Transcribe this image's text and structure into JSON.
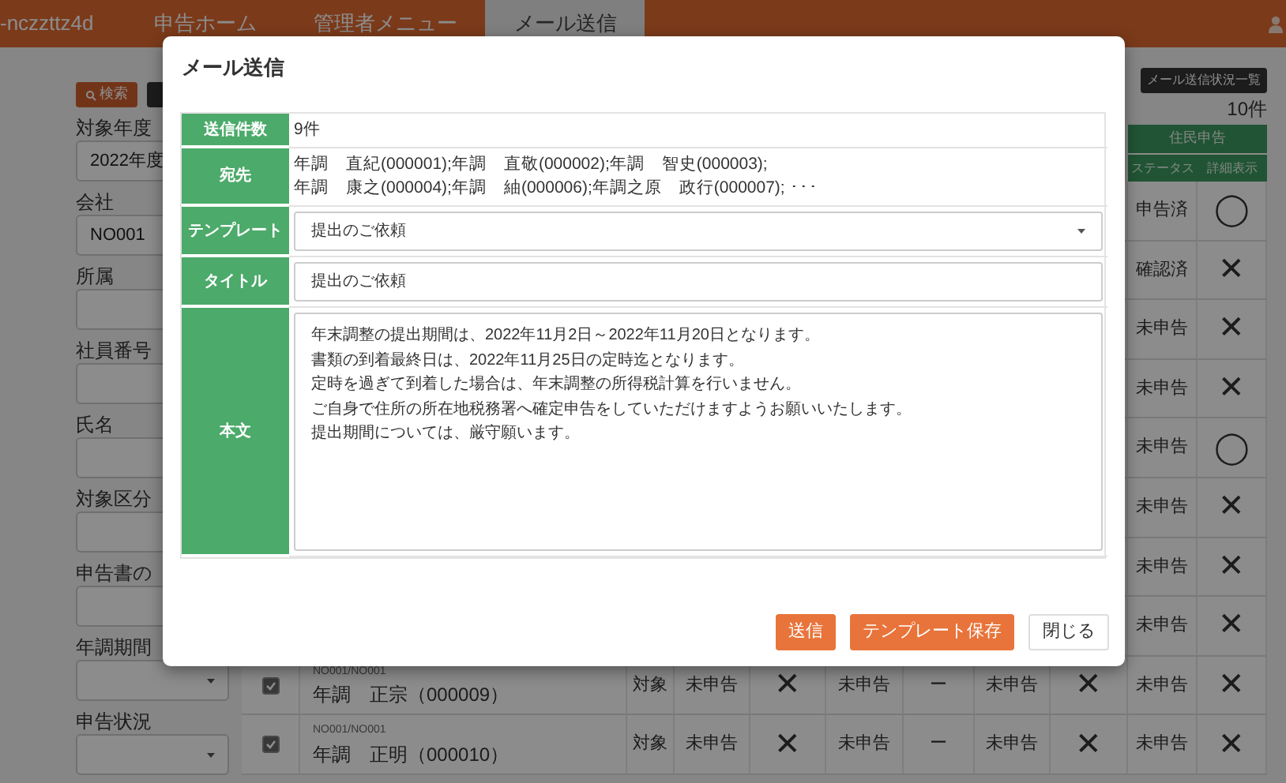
{
  "navbar": {
    "brand": "-nczzttz4d",
    "items": [
      {
        "label": "申告ホーム",
        "selected": false
      },
      {
        "label": "管理者メニュー",
        "selected": false
      },
      {
        "label": "メール送信",
        "selected": true
      }
    ]
  },
  "sidebar": {
    "search_button": "検索",
    "filters": [
      {
        "label": "対象年度",
        "kind": "select",
        "value": "2022年度"
      },
      {
        "label": "会社",
        "kind": "input",
        "value": "NO001"
      },
      {
        "label": "所属",
        "kind": "input"
      },
      {
        "label": "社員番号",
        "kind": "input"
      },
      {
        "label": "氏名",
        "kind": "input"
      },
      {
        "label": "対象区分",
        "kind": "input"
      },
      {
        "label": "申告書の",
        "kind": "input"
      },
      {
        "label": "年調期間",
        "kind": "select"
      },
      {
        "label": "申告状況",
        "kind": "select"
      }
    ]
  },
  "results": {
    "status_button": "メール送信状況一覧",
    "count": "10件",
    "header_group": "住民申告",
    "headers": [
      "ステータス",
      "詳細表示"
    ],
    "rows": [
      {
        "cells": [
          "申告済",
          "◯"
        ]
      },
      {
        "cells": [
          "確認済",
          "✕"
        ]
      },
      {
        "cells": [
          "未申告",
          "✕"
        ]
      },
      {
        "cells": [
          "未申告",
          "✕"
        ]
      },
      {
        "cells": [
          "未申告",
          "◯"
        ]
      },
      {
        "cells": [
          "未申告",
          "✕"
        ]
      },
      {
        "cells": [
          "未申告",
          "✕"
        ]
      },
      {
        "cells": [
          "未申告",
          "✕"
        ]
      },
      {
        "checked": true,
        "company": "NO001/NO001",
        "name": "年調　正宗（000009）",
        "cells": [
          "対象",
          "未申告",
          "✕",
          "未申告",
          "ー",
          "未申告",
          "✕",
          "未申告",
          "✕"
        ]
      },
      {
        "checked": true,
        "company": "NO001/NO001",
        "name": "年調　正明（000010）",
        "cells": [
          "対象",
          "未申告",
          "✕",
          "未申告",
          "ー",
          "未申告",
          "✕",
          "未申告",
          "✕"
        ]
      }
    ]
  },
  "modal": {
    "title": "メール送信",
    "fields": [
      {
        "label": "送信件数",
        "kind": "text",
        "lines": [
          "9件"
        ]
      },
      {
        "label": "宛先",
        "kind": "text",
        "lines": [
          "年調　直紀(000001);年調　直敬(000002);年調　智史(000003);",
          "年調　康之(000004);年調　紬(000006);年調之原　政行(000007); ･･･"
        ]
      },
      {
        "label": "テンプレート",
        "kind": "select",
        "value": "提出のご依頼"
      },
      {
        "label": "タイトル",
        "kind": "input",
        "value": "提出のご依頼"
      },
      {
        "label": "本文",
        "kind": "textarea",
        "lines": [
          "年末調整の提出期間は、2022年11月2日～2022年11月20日となります。",
          "書類の到着最終日は、2022年11月25日の定時迄となります。",
          "定時を過ぎて到着した場合は、年末調整の所得税計算を行いません。",
          "ご自身で住所の所在地税務署へ確定申告をしていただけますようお願いいたします。",
          "提出期間については、厳守願います。"
        ]
      }
    ],
    "buttons": [
      {
        "label": "送信",
        "kind": "primary"
      },
      {
        "label": "テンプレート保存",
        "kind": "primary"
      },
      {
        "label": "閉じる",
        "kind": "secondary"
      }
    ]
  }
}
